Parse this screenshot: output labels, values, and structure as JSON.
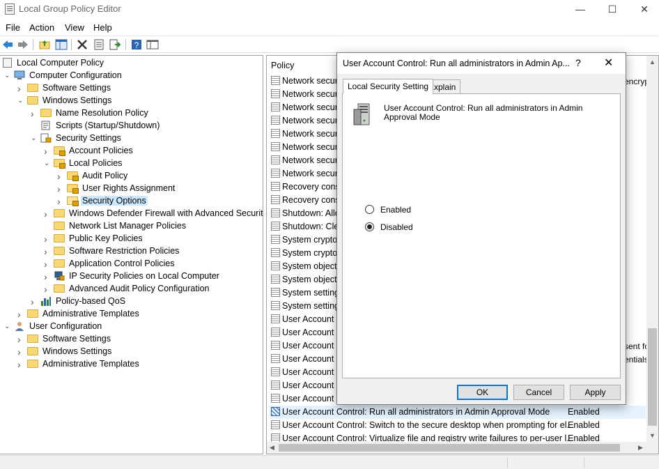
{
  "window": {
    "title": "Local Group Policy Editor",
    "minimize": "—",
    "maximize": "☐",
    "close": "✕"
  },
  "menu": [
    "File",
    "Action",
    "View",
    "Help"
  ],
  "tree": {
    "root": "Local Computer Policy",
    "items": [
      {
        "label": "Computer Configuration",
        "level": 1,
        "expander": "expanded",
        "icon": "computer-icon"
      },
      {
        "label": "Software Settings",
        "level": 2,
        "expander": "collapsed",
        "icon": "folder-icon"
      },
      {
        "label": "Windows Settings",
        "level": 2,
        "expander": "expanded",
        "icon": "folder-icon"
      },
      {
        "label": "Name Resolution Policy",
        "level": 3,
        "expander": "collapsed",
        "icon": "folder-icon"
      },
      {
        "label": "Scripts (Startup/Shutdown)",
        "level": 3,
        "expander": "none",
        "icon": "script-icon"
      },
      {
        "label": "Security Settings",
        "level": 3,
        "expander": "expanded",
        "icon": "security-settings-icon"
      },
      {
        "label": "Account Policies",
        "level": 4,
        "expander": "collapsed",
        "icon": "locked-folder-icon"
      },
      {
        "label": "Local Policies",
        "level": 4,
        "expander": "expanded",
        "icon": "locked-folder-icon"
      },
      {
        "label": "Audit Policy",
        "level": 5,
        "expander": "collapsed",
        "icon": "locked-folder-icon"
      },
      {
        "label": "User Rights Assignment",
        "level": 5,
        "expander": "collapsed",
        "icon": "locked-folder-icon"
      },
      {
        "label": "Security Options",
        "level": 5,
        "expander": "collapsed",
        "icon": "locked-folder-open-icon",
        "selected": true
      },
      {
        "label": "Windows Defender Firewall with Advanced Security",
        "level": 4,
        "expander": "collapsed",
        "icon": "folder-icon"
      },
      {
        "label": "Network List Manager Policies",
        "level": 4,
        "expander": "none",
        "icon": "folder-icon"
      },
      {
        "label": "Public Key Policies",
        "level": 4,
        "expander": "collapsed",
        "icon": "folder-icon"
      },
      {
        "label": "Software Restriction Policies",
        "level": 4,
        "expander": "collapsed",
        "icon": "folder-icon"
      },
      {
        "label": "Application Control Policies",
        "level": 4,
        "expander": "collapsed",
        "icon": "folder-icon"
      },
      {
        "label": "IP Security Policies on Local Computer",
        "level": 4,
        "expander": "collapsed",
        "icon": "ip-security-icon"
      },
      {
        "label": "Advanced Audit Policy Configuration",
        "level": 4,
        "expander": "collapsed",
        "icon": "folder-icon"
      },
      {
        "label": "Policy-based QoS",
        "level": 3,
        "expander": "collapsed",
        "icon": "qos-chart-icon"
      },
      {
        "label": "Administrative Templates",
        "level": 2,
        "expander": "collapsed",
        "icon": "folder-icon"
      },
      {
        "label": "User Configuration",
        "level": 1,
        "expander": "expanded",
        "icon": "user-icon"
      },
      {
        "label": "Software Settings",
        "level": 2,
        "expander": "collapsed",
        "icon": "folder-icon"
      },
      {
        "label": "Windows Settings",
        "level": 2,
        "expander": "collapsed",
        "icon": "folder-icon"
      },
      {
        "label": "Administrative Templates",
        "level": 2,
        "expander": "collapsed",
        "icon": "folder-icon"
      }
    ]
  },
  "list": {
    "column_policy": "Policy",
    "right_fragments": [
      "encryp",
      "sent for",
      "entials"
    ],
    "rows": [
      {
        "policy": "Network securi",
        "setting": ""
      },
      {
        "policy": "Network securi",
        "setting": ""
      },
      {
        "policy": "Network securi",
        "setting": ""
      },
      {
        "policy": "Network securi",
        "setting": ""
      },
      {
        "policy": "Network securi",
        "setting": ""
      },
      {
        "policy": "Network securi",
        "setting": ""
      },
      {
        "policy": "Network securi",
        "setting": ""
      },
      {
        "policy": "Network securi",
        "setting": ""
      },
      {
        "policy": "Recovery conso",
        "setting": ""
      },
      {
        "policy": "Recovery conso",
        "setting": ""
      },
      {
        "policy": "Shutdown: Allo",
        "setting": ""
      },
      {
        "policy": "Shutdown: Cle",
        "setting": ""
      },
      {
        "policy": "System cryptog",
        "setting": ""
      },
      {
        "policy": "System cryptog",
        "setting": ""
      },
      {
        "policy": "System objects",
        "setting": ""
      },
      {
        "policy": "System objects",
        "setting": ""
      },
      {
        "policy": "System settings",
        "setting": ""
      },
      {
        "policy": "System settings",
        "setting": ""
      },
      {
        "policy": "User Account C",
        "setting": ""
      },
      {
        "policy": "User Account C",
        "setting": ""
      },
      {
        "policy": "User Account C",
        "setting": ""
      },
      {
        "policy": "User Account C",
        "setting": ""
      },
      {
        "policy": "User Account C",
        "setting": ""
      },
      {
        "policy": "User Account C",
        "setting": ""
      },
      {
        "policy": "User Account C",
        "setting": ""
      },
      {
        "policy": "User Account Control: Run all administrators in Admin Approval Mode",
        "setting": "Enabled",
        "highlighted": true
      },
      {
        "policy": "User Account Control: Switch to the secure desktop when prompting for el...",
        "setting": "Enabled"
      },
      {
        "policy": "User Account Control: Virtualize file and registry write failures to per-user l...",
        "setting": "Enabled"
      }
    ]
  },
  "dialog": {
    "title": "User Account Control: Run all administrators in Admin Ap...",
    "help": "?",
    "close": "✕",
    "tabs": [
      "Local Security Setting",
      "Explain"
    ],
    "active_tab": "Local Security Setting",
    "policy_name": "User Account Control: Run all administrators in Admin Approval Mode",
    "options": [
      {
        "label": "Enabled",
        "checked": false
      },
      {
        "label": "Disabled",
        "checked": true
      }
    ],
    "buttons": {
      "ok": "OK",
      "cancel": "Cancel",
      "apply": "Apply"
    }
  }
}
